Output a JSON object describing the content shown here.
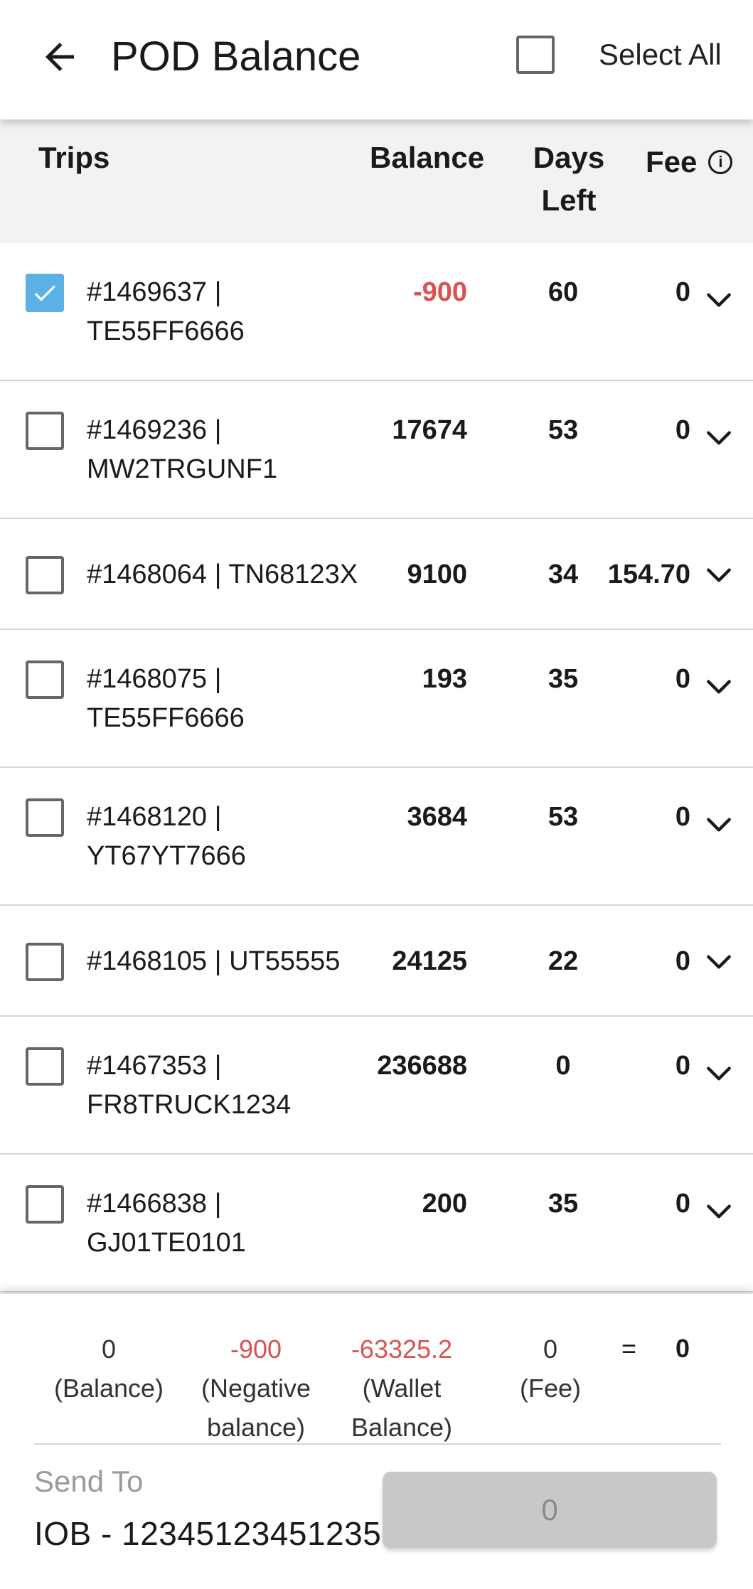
{
  "header": {
    "title": "POD Balance",
    "select_all_label": "Select All",
    "select_all_checked": false
  },
  "columns": {
    "trips": "Trips",
    "balance": "Balance",
    "days_left_1": "Days",
    "days_left_2": "Left",
    "fee": "Fee"
  },
  "rows": [
    {
      "id": "#1469637 |",
      "vehicle": "TE55FF6666",
      "balance": "-900",
      "negative": true,
      "days": "60",
      "fee": "0",
      "checked": true
    },
    {
      "id": "#1469236 |",
      "vehicle": "MW2TRGUNF1",
      "balance": "17674",
      "negative": false,
      "days": "53",
      "fee": "0",
      "checked": false
    },
    {
      "id": "#1468064 |",
      "vehicle": "TN68123X",
      "balance": "9100",
      "negative": false,
      "days": "34",
      "fee": "154.70",
      "checked": false,
      "single_line": true
    },
    {
      "id": "#1468075 |",
      "vehicle": "TE55FF6666",
      "balance": "193",
      "negative": false,
      "days": "35",
      "fee": "0",
      "checked": false
    },
    {
      "id": "#1468120 |",
      "vehicle": "YT67YT7666",
      "balance": "3684",
      "negative": false,
      "days": "53",
      "fee": "0",
      "checked": false
    },
    {
      "id": "#1468105 |",
      "vehicle": "UT55555",
      "balance": "24125",
      "negative": false,
      "days": "22",
      "fee": "0",
      "checked": false,
      "single_line": true
    },
    {
      "id": "#1467353 |",
      "vehicle": "FR8TRUCK1234",
      "balance": "236688",
      "negative": false,
      "days": "0",
      "fee": "0",
      "checked": false
    },
    {
      "id": "#1466838 |",
      "vehicle": "GJ01TE0101",
      "balance": "200",
      "negative": false,
      "days": "35",
      "fee": "0",
      "checked": false
    }
  ],
  "summary": {
    "balance_value": "0",
    "balance_label": "(Balance)",
    "neg_value": "-900",
    "neg_label_1": "(Negative",
    "neg_label_2": "balance)",
    "wallet_value": "-63325.2",
    "wallet_label_1": "(Wallet",
    "wallet_label_2": "Balance)",
    "fee_value": "0",
    "fee_label": "(Fee)",
    "equals": "=",
    "total": "0"
  },
  "send": {
    "label": "Send To",
    "account": "IOB - 12345123451235",
    "button_label": "0"
  },
  "colors": {
    "negative": "#d9534f",
    "checkbox_checked": "#5bb0e6",
    "disabled_button": "#c8c8c8"
  }
}
